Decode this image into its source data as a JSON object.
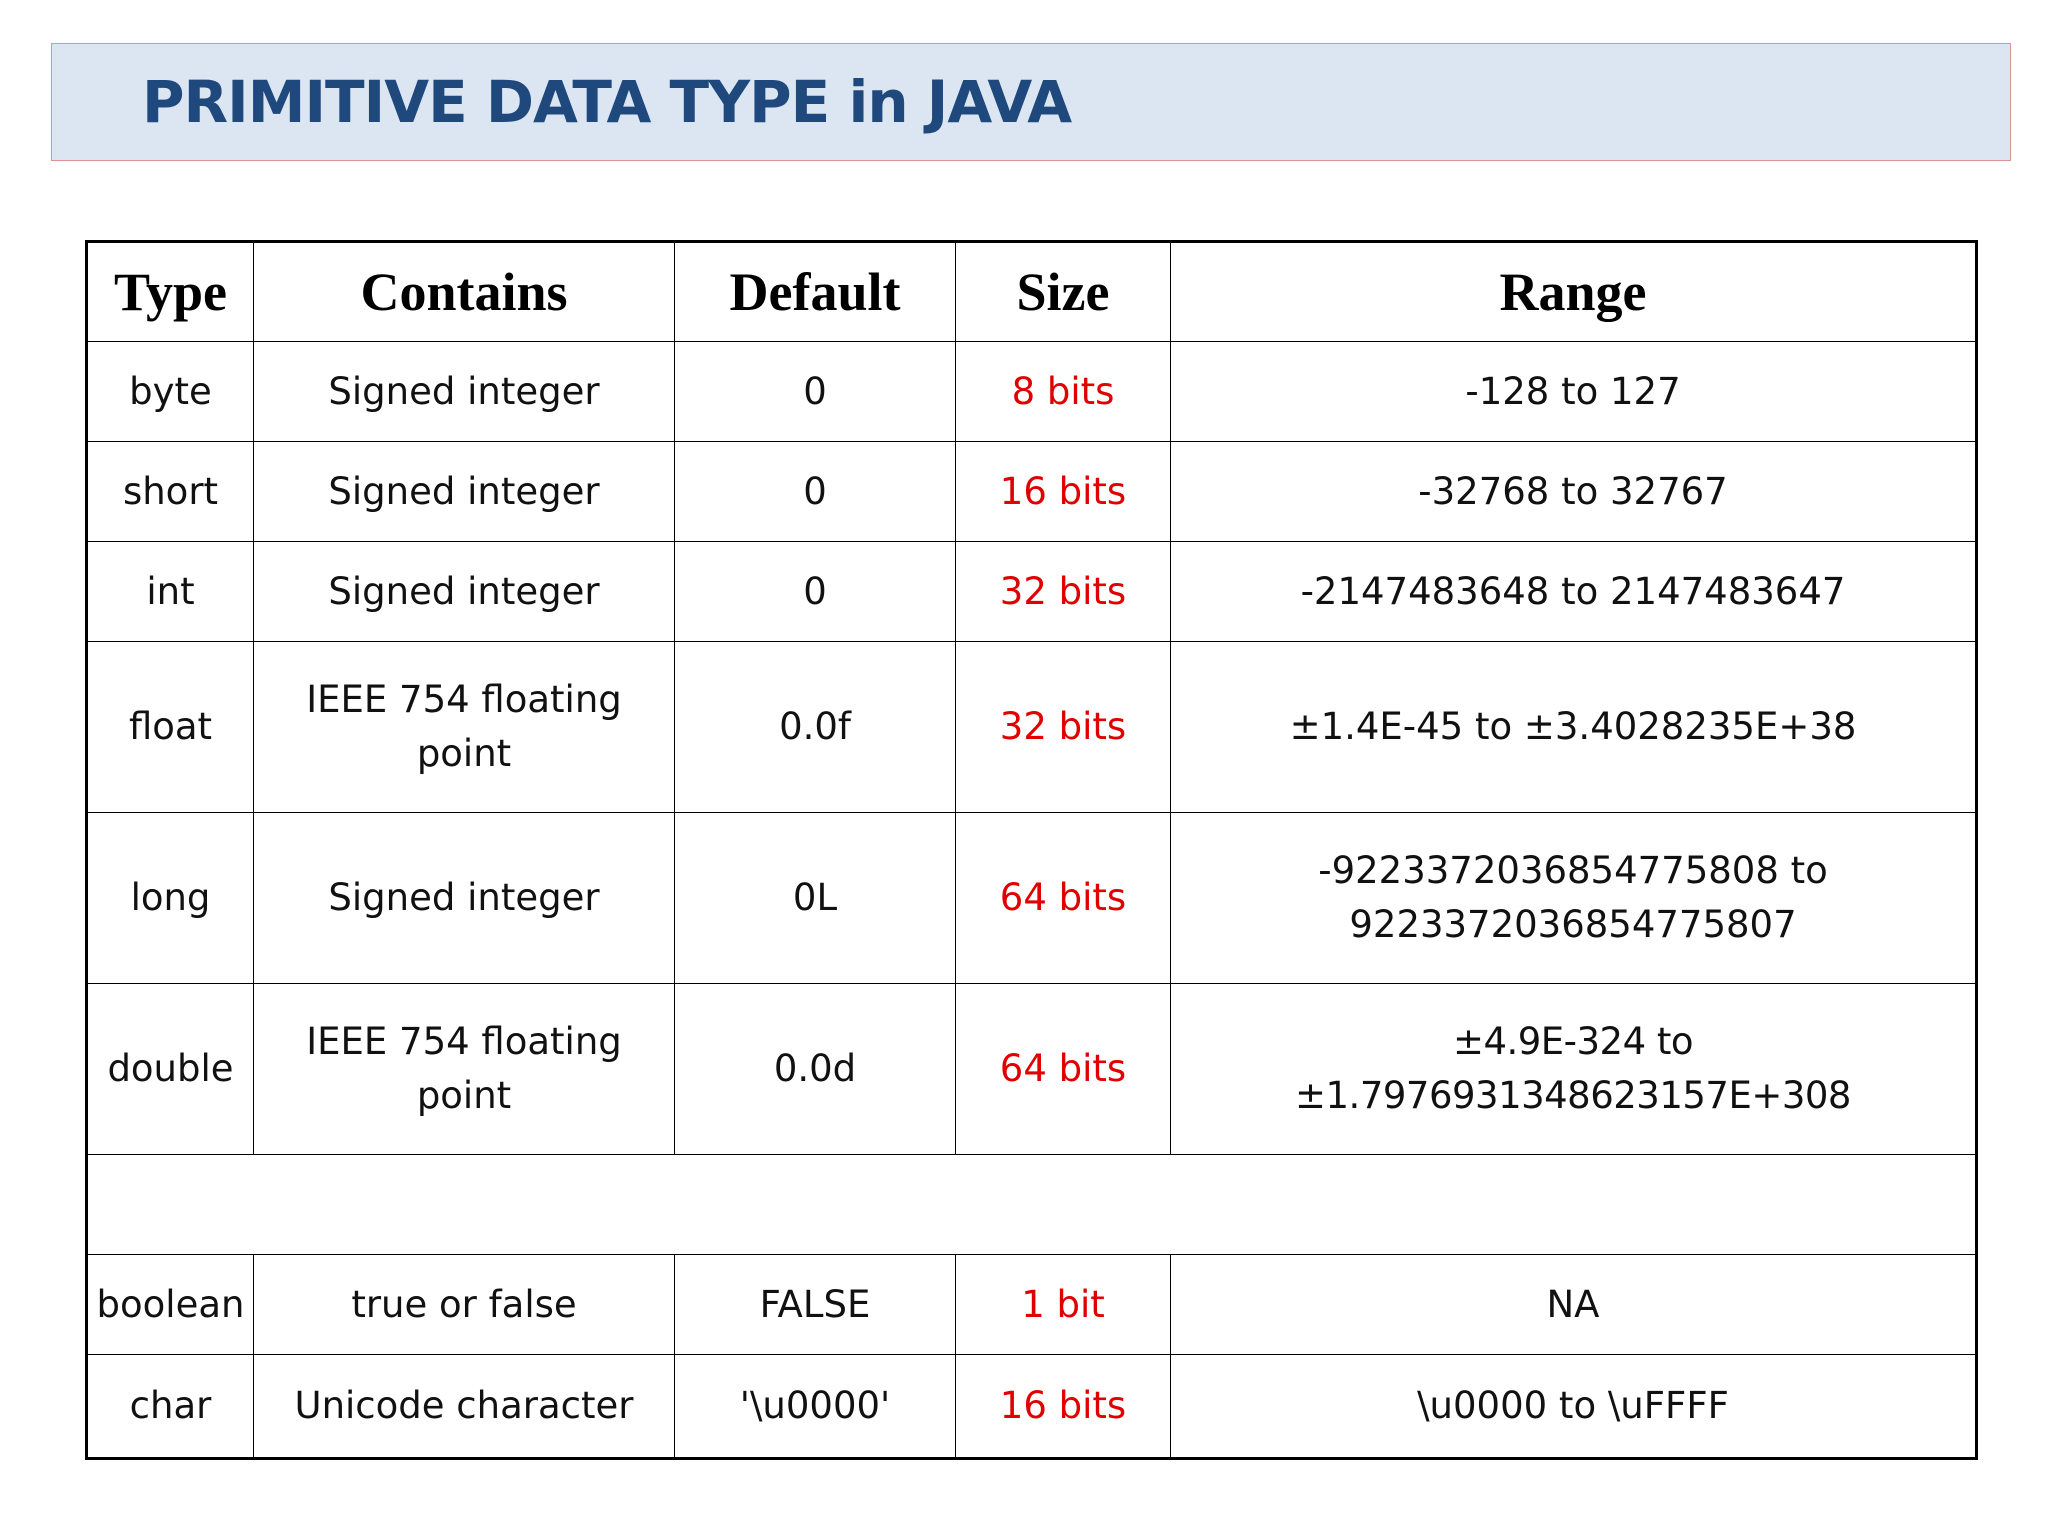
{
  "title": "PRIMITIVE DATA TYPE in JAVA",
  "colors": {
    "title_text": "#1f497d",
    "title_bg": "#dce6f2",
    "title_border": "#d99594",
    "size_text": "#e00000"
  },
  "table": {
    "headers": {
      "type": "Type",
      "contains": "Contains",
      "default": "Default",
      "size": "Size",
      "range": "Range"
    },
    "rows": [
      {
        "type": "byte",
        "contains": "Signed integer",
        "default": "0",
        "size": "8 bits",
        "range": "-128 to 127"
      },
      {
        "type": "short",
        "contains": "Signed integer",
        "default": "0",
        "size": "16 bits",
        "range": "-32768 to 32767"
      },
      {
        "type": "int",
        "contains": "Signed integer",
        "default": "0",
        "size": "32 bits",
        "range": "-2147483648 to 2147483647"
      },
      {
        "type": "float",
        "contains": "IEEE 754 floating point",
        "default": "0.0f",
        "size": "32 bits",
        "range": "±1.4E-45 to ±3.4028235E+38"
      },
      {
        "type": "long",
        "contains": "Signed integer",
        "default": "0L",
        "size": "64 bits",
        "range": "-9223372036854775808 to 9223372036854775807"
      },
      {
        "type": "double",
        "contains": "IEEE 754 floating point",
        "default": "0.0d",
        "size": "64 bits",
        "range": "±4.9E-324 to ±1.7976931348623157E+308"
      },
      {
        "type": "boolean",
        "contains": "true or false",
        "default": "FALSE",
        "size": "1 bit",
        "range": "NA"
      },
      {
        "type": "char",
        "contains": "Unicode character",
        "default": "'\\u0000'",
        "size": "16 bits",
        "range": "\\u0000 to \\uFFFF"
      }
    ]
  }
}
